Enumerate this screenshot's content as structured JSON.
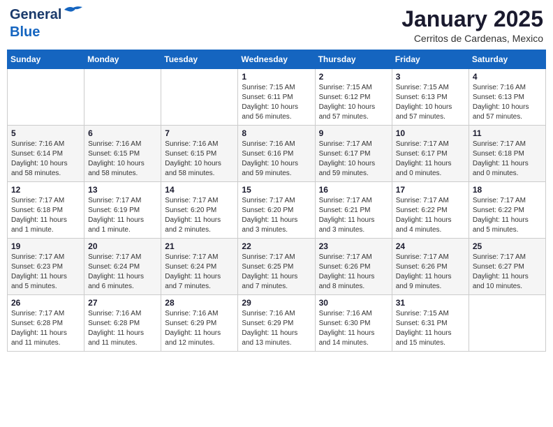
{
  "header": {
    "logo_line1": "General",
    "logo_line2": "Blue",
    "month": "January 2025",
    "location": "Cerritos de Cardenas, Mexico"
  },
  "weekdays": [
    "Sunday",
    "Monday",
    "Tuesday",
    "Wednesday",
    "Thursday",
    "Friday",
    "Saturday"
  ],
  "weeks": [
    [
      {
        "num": "",
        "info": ""
      },
      {
        "num": "",
        "info": ""
      },
      {
        "num": "",
        "info": ""
      },
      {
        "num": "1",
        "info": "Sunrise: 7:15 AM\nSunset: 6:11 PM\nDaylight: 10 hours\nand 56 minutes."
      },
      {
        "num": "2",
        "info": "Sunrise: 7:15 AM\nSunset: 6:12 PM\nDaylight: 10 hours\nand 57 minutes."
      },
      {
        "num": "3",
        "info": "Sunrise: 7:15 AM\nSunset: 6:13 PM\nDaylight: 10 hours\nand 57 minutes."
      },
      {
        "num": "4",
        "info": "Sunrise: 7:16 AM\nSunset: 6:13 PM\nDaylight: 10 hours\nand 57 minutes."
      }
    ],
    [
      {
        "num": "5",
        "info": "Sunrise: 7:16 AM\nSunset: 6:14 PM\nDaylight: 10 hours\nand 58 minutes."
      },
      {
        "num": "6",
        "info": "Sunrise: 7:16 AM\nSunset: 6:15 PM\nDaylight: 10 hours\nand 58 minutes."
      },
      {
        "num": "7",
        "info": "Sunrise: 7:16 AM\nSunset: 6:15 PM\nDaylight: 10 hours\nand 58 minutes."
      },
      {
        "num": "8",
        "info": "Sunrise: 7:16 AM\nSunset: 6:16 PM\nDaylight: 10 hours\nand 59 minutes."
      },
      {
        "num": "9",
        "info": "Sunrise: 7:17 AM\nSunset: 6:17 PM\nDaylight: 10 hours\nand 59 minutes."
      },
      {
        "num": "10",
        "info": "Sunrise: 7:17 AM\nSunset: 6:17 PM\nDaylight: 11 hours\nand 0 minutes."
      },
      {
        "num": "11",
        "info": "Sunrise: 7:17 AM\nSunset: 6:18 PM\nDaylight: 11 hours\nand 0 minutes."
      }
    ],
    [
      {
        "num": "12",
        "info": "Sunrise: 7:17 AM\nSunset: 6:18 PM\nDaylight: 11 hours\nand 1 minute."
      },
      {
        "num": "13",
        "info": "Sunrise: 7:17 AM\nSunset: 6:19 PM\nDaylight: 11 hours\nand 1 minute."
      },
      {
        "num": "14",
        "info": "Sunrise: 7:17 AM\nSunset: 6:20 PM\nDaylight: 11 hours\nand 2 minutes."
      },
      {
        "num": "15",
        "info": "Sunrise: 7:17 AM\nSunset: 6:20 PM\nDaylight: 11 hours\nand 3 minutes."
      },
      {
        "num": "16",
        "info": "Sunrise: 7:17 AM\nSunset: 6:21 PM\nDaylight: 11 hours\nand 3 minutes."
      },
      {
        "num": "17",
        "info": "Sunrise: 7:17 AM\nSunset: 6:22 PM\nDaylight: 11 hours\nand 4 minutes."
      },
      {
        "num": "18",
        "info": "Sunrise: 7:17 AM\nSunset: 6:22 PM\nDaylight: 11 hours\nand 5 minutes."
      }
    ],
    [
      {
        "num": "19",
        "info": "Sunrise: 7:17 AM\nSunset: 6:23 PM\nDaylight: 11 hours\nand 5 minutes."
      },
      {
        "num": "20",
        "info": "Sunrise: 7:17 AM\nSunset: 6:24 PM\nDaylight: 11 hours\nand 6 minutes."
      },
      {
        "num": "21",
        "info": "Sunrise: 7:17 AM\nSunset: 6:24 PM\nDaylight: 11 hours\nand 7 minutes."
      },
      {
        "num": "22",
        "info": "Sunrise: 7:17 AM\nSunset: 6:25 PM\nDaylight: 11 hours\nand 7 minutes."
      },
      {
        "num": "23",
        "info": "Sunrise: 7:17 AM\nSunset: 6:26 PM\nDaylight: 11 hours\nand 8 minutes."
      },
      {
        "num": "24",
        "info": "Sunrise: 7:17 AM\nSunset: 6:26 PM\nDaylight: 11 hours\nand 9 minutes."
      },
      {
        "num": "25",
        "info": "Sunrise: 7:17 AM\nSunset: 6:27 PM\nDaylight: 11 hours\nand 10 minutes."
      }
    ],
    [
      {
        "num": "26",
        "info": "Sunrise: 7:17 AM\nSunset: 6:28 PM\nDaylight: 11 hours\nand 11 minutes."
      },
      {
        "num": "27",
        "info": "Sunrise: 7:16 AM\nSunset: 6:28 PM\nDaylight: 11 hours\nand 11 minutes."
      },
      {
        "num": "28",
        "info": "Sunrise: 7:16 AM\nSunset: 6:29 PM\nDaylight: 11 hours\nand 12 minutes."
      },
      {
        "num": "29",
        "info": "Sunrise: 7:16 AM\nSunset: 6:29 PM\nDaylight: 11 hours\nand 13 minutes."
      },
      {
        "num": "30",
        "info": "Sunrise: 7:16 AM\nSunset: 6:30 PM\nDaylight: 11 hours\nand 14 minutes."
      },
      {
        "num": "31",
        "info": "Sunrise: 7:15 AM\nSunset: 6:31 PM\nDaylight: 11 hours\nand 15 minutes."
      },
      {
        "num": "",
        "info": ""
      }
    ]
  ]
}
